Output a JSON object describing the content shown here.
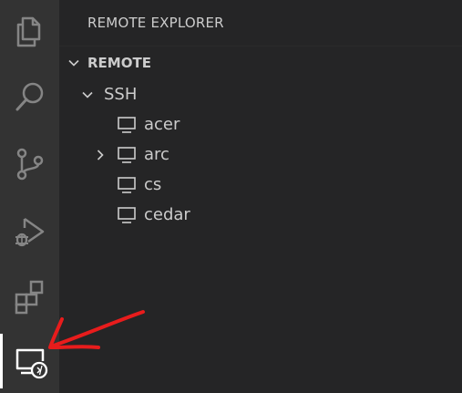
{
  "sidebar": {
    "title": "REMOTE EXPLORER",
    "section": {
      "label": "REMOTE",
      "expanded": true
    },
    "tree": {
      "group": {
        "label": "SSH",
        "expanded": true
      },
      "hosts": [
        {
          "label": "acer",
          "has_children": false
        },
        {
          "label": "arc",
          "has_children": true,
          "expanded": false
        },
        {
          "label": "cs",
          "has_children": false
        },
        {
          "label": "cedar",
          "has_children": false
        }
      ]
    }
  },
  "activity_bar": {
    "items": [
      {
        "icon": "files-icon",
        "active": false
      },
      {
        "icon": "search-icon",
        "active": false
      },
      {
        "icon": "source-control-icon",
        "active": false
      },
      {
        "icon": "run-debug-icon",
        "active": false
      },
      {
        "icon": "extensions-icon",
        "active": false
      },
      {
        "icon": "remote-explorer-icon",
        "active": true
      }
    ]
  },
  "annotation": {
    "color": "#e81c1c"
  },
  "colors": {
    "activity_bar": "#333333",
    "sidebar": "#252526",
    "text": "#cccccc",
    "icon_inactive": "#858585",
    "icon_active": "#ffffff"
  }
}
